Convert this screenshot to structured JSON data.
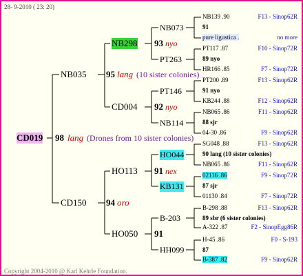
{
  "header_date": "28- 9-2010 ( 23: 20)",
  "footer": "Copyright 2004-2010 @ Karl Kehrle Foundation.",
  "root": {
    "id": "CD019",
    "gen": "98",
    "breed": "lang",
    "note": "(Drones from 10 sister colonies)"
  },
  "gen1": {
    "sire": {
      "id": "NB035",
      "gen": "95",
      "breed": "lang",
      "note": "(10 sister colonies)"
    },
    "dam": {
      "id": "CD150",
      "gen": "94",
      "breed": "oro"
    }
  },
  "gen2": [
    {
      "id": "NB298"
    },
    {
      "id": "CD004",
      "gen": "92",
      "breed": "nyo"
    },
    {
      "id": "HO113",
      "gen": "91",
      "breed": "nex"
    },
    {
      "id": "HO050",
      "gen": "91"
    }
  ],
  "gen2_extra": {
    "nb298_gen": "93",
    "nb298_breed": "nyo"
  },
  "gen3": [
    {
      "id": "NB073"
    },
    {
      "id": "PT263"
    },
    {
      "id": "PT146"
    },
    {
      "id": "NB114"
    },
    {
      "id": "HO044"
    },
    {
      "id": "KB131"
    },
    {
      "id": "B-203"
    },
    {
      "id": "HH099"
    }
  ],
  "gen3_marks": {
    "pt146_gen": "91",
    "pt146_breed": "nyo",
    "nb114_gen": "88",
    "nb114_breed": "sjr",
    "kb131_gen": "87",
    "kb131_breed": "sjr",
    "b203_gen": "89",
    "b203_breed": "sbr",
    "b203_note": "(6 sister colonies)",
    "hh099_gen": "87",
    "nb073_gen": "91",
    "ho044_gen": "90",
    "ho044_breed": "lang",
    "ho044_note": "(10 sister colonies)"
  },
  "right": [
    {
      "left": "NB139 .90",
      "right": "F13 - Sinop62R"
    },
    {
      "left": "91",
      "right": ""
    },
    {
      "left": "pure ligustica .",
      "right": "no more"
    },
    {
      "left": "PT117 .87",
      "right": "F10 - Sinop72R"
    },
    {
      "left": "89 nyo",
      "right": ""
    },
    {
      "left": "HR166 .85",
      "right": "F7 - Sinop72R"
    },
    {
      "left": "PT200 .89",
      "right": "F13 - Sinop62R"
    },
    {
      "left": "91 nyo",
      "right": ""
    },
    {
      "left": "KB244 .88",
      "right": "F12 - Sinop62R"
    },
    {
      "left": "NB065 .86",
      "right": "F11 - Sinop62R"
    },
    {
      "left": "88 sjr",
      "right": ""
    },
    {
      "left": "04-30 .86",
      "right": "F9 - Sinop62R"
    },
    {
      "left": "SG048 .88",
      "right": "F13 - Sinop62R"
    },
    {
      "left": "90 lang (10 sister colonies)",
      "right": ""
    },
    {
      "left": "NB065 .86",
      "right": "F11 - Sinop62R"
    },
    {
      "left": "02116 .86",
      "right": "F9 - Sinop72R"
    },
    {
      "left": "87 sjr",
      "right": ""
    },
    {
      "left": "01130 .84",
      "right": "F7 - Sinop72R"
    },
    {
      "left": "B-298 .88",
      "right": "F13 - Sinop62R"
    },
    {
      "left": "89 sbr (6 sister colonies)",
      "right": ""
    },
    {
      "left": "A-322 .87",
      "right": "F2 - SinopEgg86R"
    },
    {
      "left": "H-45 .86",
      "right": "F0 - S-193"
    },
    {
      "left": "87",
      "right": ""
    },
    {
      "left": "B-387 .82",
      "right": "F9 - Sinop62R"
    }
  ]
}
